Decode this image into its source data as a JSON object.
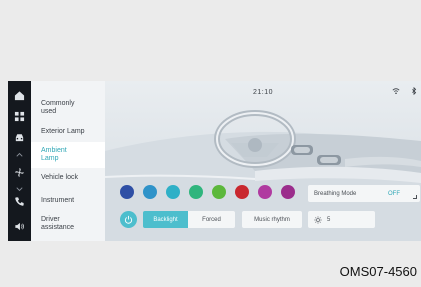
{
  "status_bar": {
    "time": "21:10",
    "icons": [
      "wifi-icon",
      "bluetooth-icon"
    ]
  },
  "rail": {
    "icons": [
      "home-icon",
      "apps-grid-icon",
      "car-icon",
      "fan-icon",
      "phone-icon",
      "volume-icon"
    ]
  },
  "menu": {
    "items": [
      {
        "label": "Commonly\nused",
        "active": false
      },
      {
        "label": "Exterior Lamp",
        "active": false
      },
      {
        "label": "Ambient\nLamp",
        "active": true
      },
      {
        "label": "Vehicle lock",
        "active": false
      },
      {
        "label": "Instrument",
        "active": false
      },
      {
        "label": "Driver\nassistance",
        "active": false
      }
    ]
  },
  "ambient": {
    "colors": [
      "#2e4fa5",
      "#2f93c9",
      "#2fb0c7",
      "#2fb57d",
      "#5cb83c",
      "#c9282f",
      "#b03aa0",
      "#9b2d8c"
    ],
    "breathing_mode": {
      "label": "Breathing Mode",
      "value": "OFF"
    },
    "mode_buttons": {
      "active": "Backlight",
      "inactive": "Forced"
    },
    "music_rhythm": "Music rhythm",
    "brightness": "5"
  },
  "caption": "OMS07-4560",
  "theme": {
    "accent": "#4dbecd",
    "rail": "#14181e"
  }
}
